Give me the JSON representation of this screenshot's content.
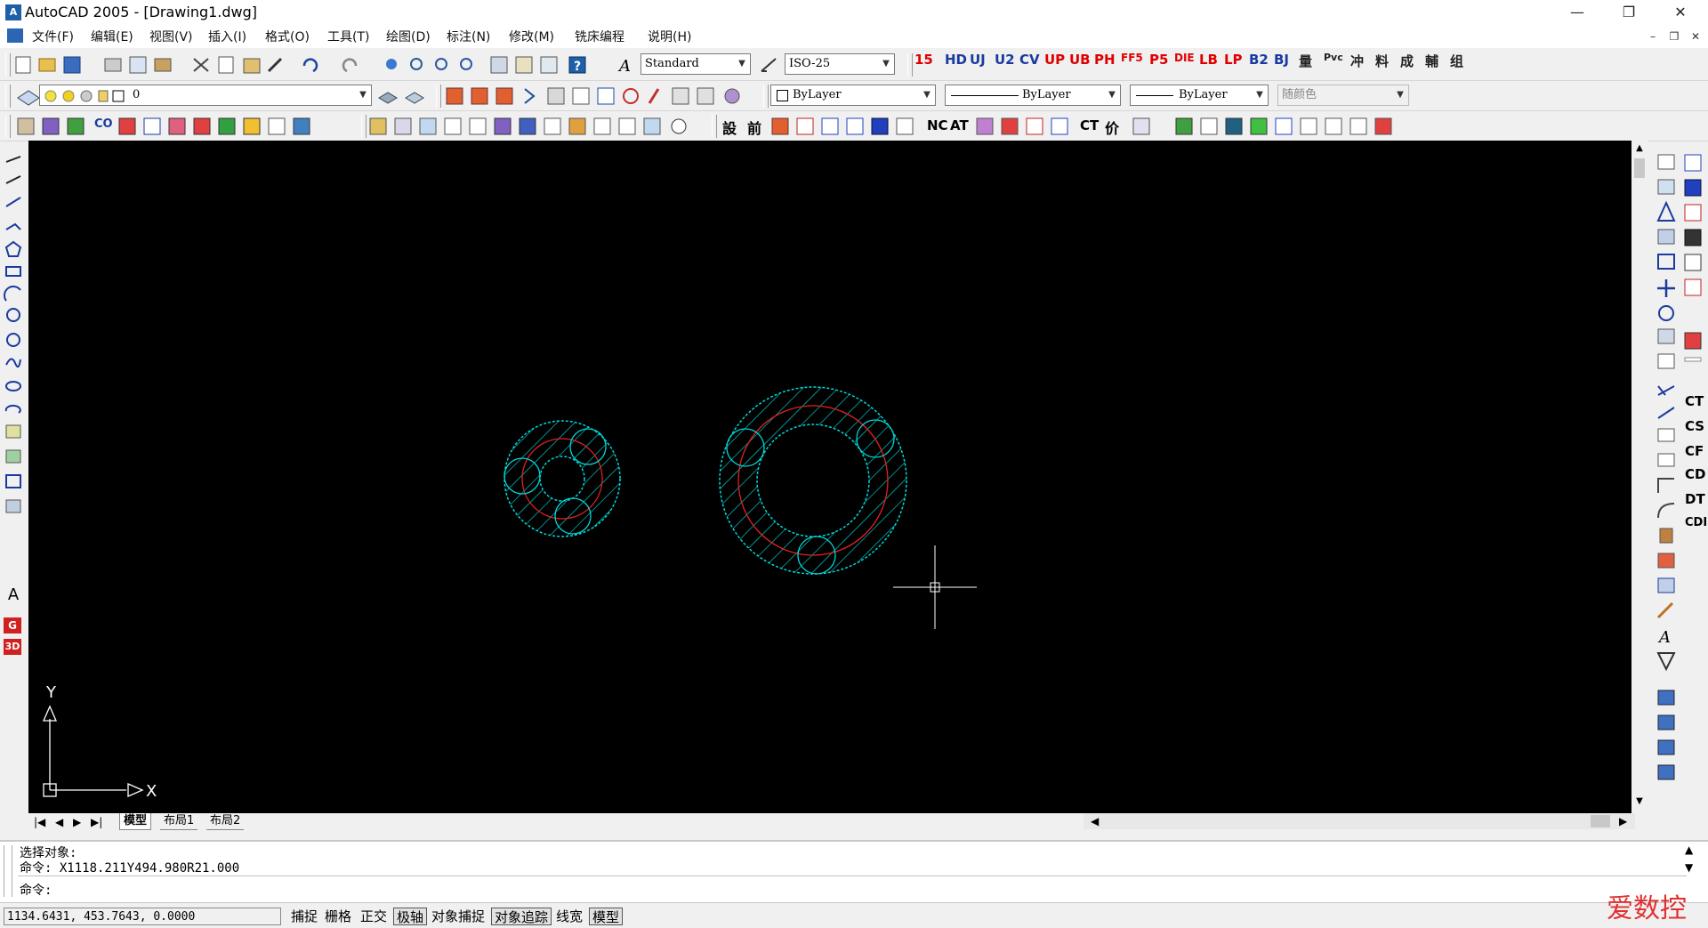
{
  "window": {
    "title": "AutoCAD 2005 - [Drawing1.dwg]",
    "minimize": "—",
    "restore": "❐",
    "close": "✕"
  },
  "menu": {
    "items": [
      "文件(F)",
      "编辑(E)",
      "视图(V)",
      "插入(I)",
      "格式(O)",
      "工具(T)",
      "绘图(D)",
      "标注(N)",
      "修改(M)",
      "铣床编程",
      "说明(H)"
    ],
    "mdi_minimize": "–",
    "mdi_restore": "❐",
    "mdi_close": "✕"
  },
  "toolbar": {
    "text_style": "Standard",
    "dim_style": "ISO-25",
    "layer": "0",
    "color": "ByLayer",
    "linetype": "ByLayer",
    "lineweight": "ByLayer",
    "plot_style": "随颜色",
    "custom_buttons": [
      "15",
      "HD",
      "UJ",
      "U2",
      "CV",
      "UP",
      "UB",
      "PH",
      "FF5",
      "P5",
      "DIE",
      "LB",
      "LP",
      "B2",
      "BJ",
      "量",
      "Pvc",
      "冲",
      "料",
      "成",
      "輔",
      "组"
    ],
    "row3_labels": [
      "CO",
      "設",
      "前",
      "NC",
      "AT",
      "CT",
      "价"
    ]
  },
  "left_toolbar": {
    "text_tool": "A",
    "g_button": "G",
    "three_d_button": "3D"
  },
  "right_toolbar": {
    "labels": [
      "CT",
      "CS",
      "CF",
      "CD",
      "DT",
      "CDI"
    ]
  },
  "ucs": {
    "x_label": "X",
    "y_label": "Y"
  },
  "tabs": [
    "模型",
    "布局1",
    "布局2"
  ],
  "command": {
    "line1": "选择对象:",
    "line2": "命令: X1118.211Y494.980R21.000",
    "prompt": "命令:"
  },
  "status": {
    "coords": "1134.6431, 453.7643, 0.0000",
    "buttons": [
      {
        "label": "捕捉",
        "on": false
      },
      {
        "label": "栅格",
        "on": false
      },
      {
        "label": "正交",
        "on": false
      },
      {
        "label": "极轴",
        "on": true
      },
      {
        "label": "对象捕捉",
        "on": false
      },
      {
        "label": "对象追踪",
        "on": true
      },
      {
        "label": "线宽",
        "on": false
      },
      {
        "label": "模型",
        "on": true
      }
    ]
  },
  "watermark": "爱数控",
  "colors": {
    "canvas": "#000000",
    "hatch": "#00d7d7",
    "centerline": "#e02020",
    "crosshair": "#ffffff"
  }
}
